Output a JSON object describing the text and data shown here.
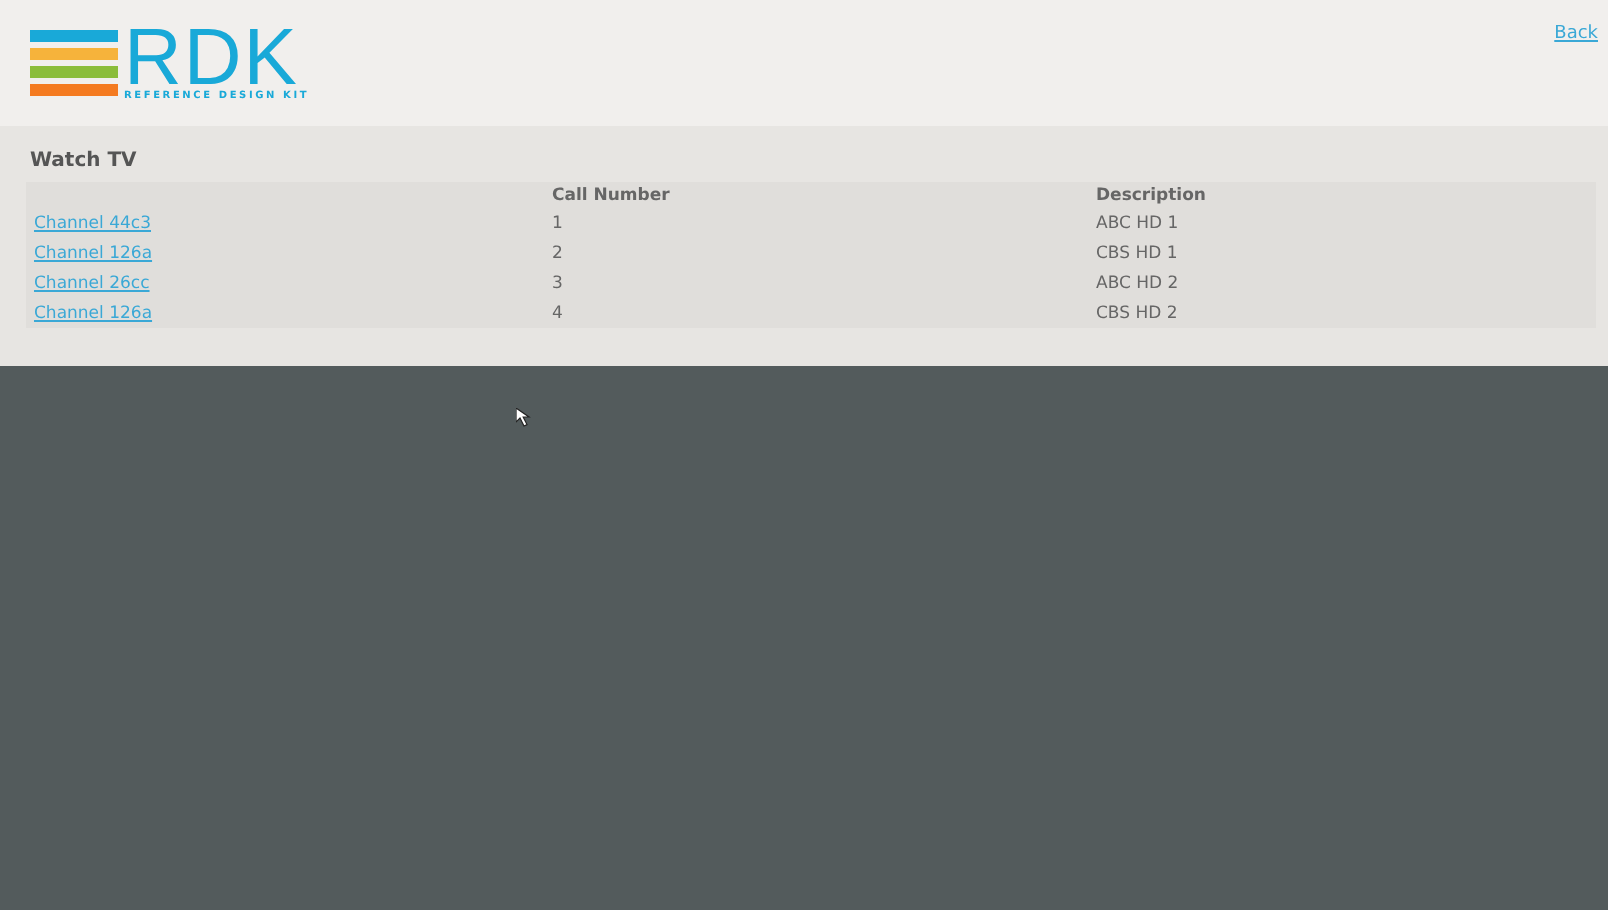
{
  "header": {
    "logo": {
      "name": "RDK",
      "tagline": "REFERENCE DESIGN KIT"
    },
    "back_link": "Back"
  },
  "section": {
    "title": "Watch TV"
  },
  "table": {
    "columns": [
      "",
      "Call Number",
      "Description"
    ],
    "rows": [
      {
        "channel": "Channel 44c3",
        "call_number": "1",
        "description": "ABC HD 1"
      },
      {
        "channel": "Channel 126a",
        "call_number": "2",
        "description": "CBS HD 1"
      },
      {
        "channel": "Channel 26cc",
        "call_number": "3",
        "description": "ABC HD 2"
      },
      {
        "channel": "Channel 126a",
        "call_number": "4",
        "description": "CBS HD 2"
      }
    ]
  }
}
